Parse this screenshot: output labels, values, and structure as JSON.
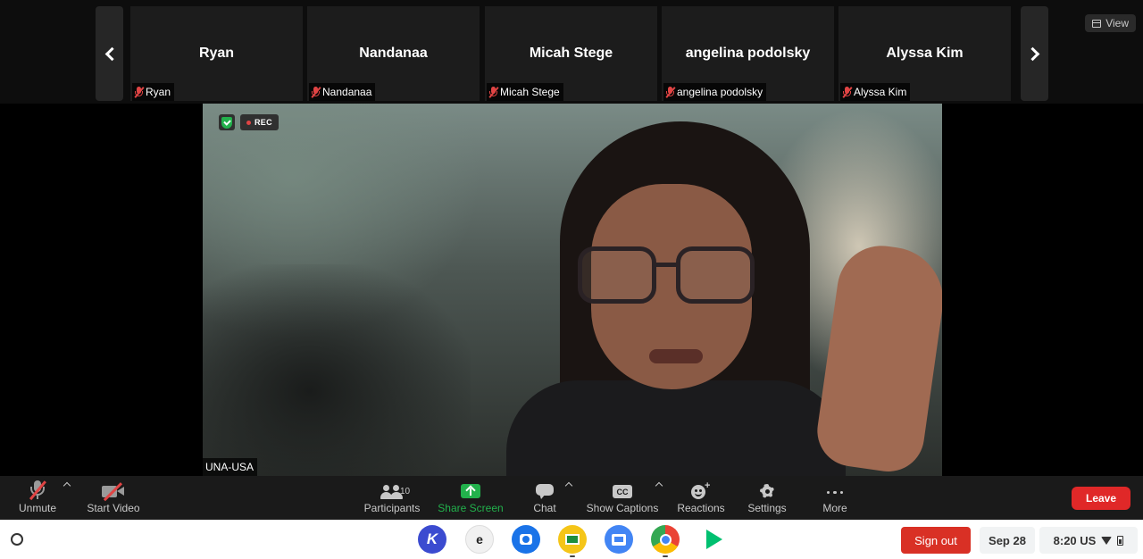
{
  "view_button": {
    "label": "View",
    "icon": "grid-icon"
  },
  "participant_strip": [
    {
      "name": "Ryan",
      "label": "Ryan"
    },
    {
      "name": "Nandanaa",
      "label": "Nandanaa"
    },
    {
      "name": "Micah Stege",
      "label": "Micah Stege"
    },
    {
      "name": "angelina podolsky",
      "label": "angelina podolsky"
    },
    {
      "name": "Alyssa Kim",
      "label": "Alyssa Kim"
    }
  ],
  "main_video": {
    "label": "UNA-USA",
    "rec_label": "REC"
  },
  "toolbar": {
    "unmute": "Unmute",
    "start_video": "Start Video",
    "participants": "Participants",
    "participant_count": "10",
    "share_screen": "Share Screen",
    "chat": "Chat",
    "show_captions": "Show Captions",
    "cc_icon_text": "CC",
    "reactions": "Reactions",
    "settings": "Settings",
    "more": "More",
    "leave": "Leave"
  },
  "shelf": {
    "sign_out": "Sign out",
    "date": "Sep 28",
    "status": "8:20 US",
    "apps": [
      "kami",
      "edpuzzle",
      "camera",
      "google-classroom",
      "screencastify",
      "chrome",
      "play-store"
    ],
    "app_letters": {
      "kami": "K",
      "edpuzzle": "e"
    }
  },
  "colors": {
    "leave": "#e02828",
    "share_green": "#22b14c",
    "muted_red": "#e04444",
    "sign_out": "#d93025"
  }
}
